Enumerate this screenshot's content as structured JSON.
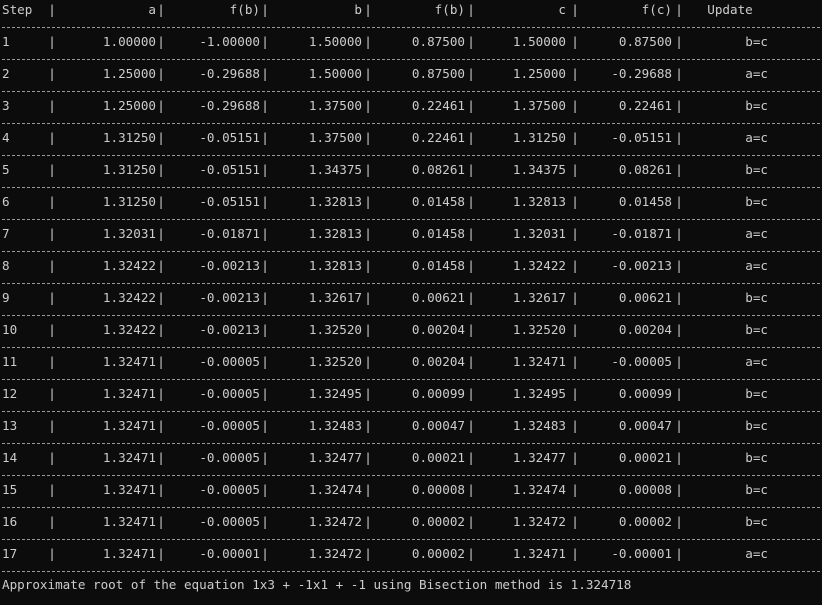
{
  "table": {
    "headers": [
      "Step",
      "a",
      "f(b)",
      "b",
      "f(b)",
      "c",
      "f(c)",
      "Update"
    ],
    "rows": [
      [
        "1",
        "1.00000",
        "-1.00000",
        "1.50000",
        "0.87500",
        "1.50000",
        "0.87500",
        "b=c"
      ],
      [
        "2",
        "1.25000",
        "-0.29688",
        "1.50000",
        "0.87500",
        "1.25000",
        "-0.29688",
        "a=c"
      ],
      [
        "3",
        "1.25000",
        "-0.29688",
        "1.37500",
        "0.22461",
        "1.37500",
        "0.22461",
        "b=c"
      ],
      [
        "4",
        "1.31250",
        "-0.05151",
        "1.37500",
        "0.22461",
        "1.31250",
        "-0.05151",
        "a=c"
      ],
      [
        "5",
        "1.31250",
        "-0.05151",
        "1.34375",
        "0.08261",
        "1.34375",
        "0.08261",
        "b=c"
      ],
      [
        "6",
        "1.31250",
        "-0.05151",
        "1.32813",
        "0.01458",
        "1.32813",
        "0.01458",
        "b=c"
      ],
      [
        "7",
        "1.32031",
        "-0.01871",
        "1.32813",
        "0.01458",
        "1.32031",
        "-0.01871",
        "a=c"
      ],
      [
        "8",
        "1.32422",
        "-0.00213",
        "1.32813",
        "0.01458",
        "1.32422",
        "-0.00213",
        "a=c"
      ],
      [
        "9",
        "1.32422",
        "-0.00213",
        "1.32617",
        "0.00621",
        "1.32617",
        "0.00621",
        "b=c"
      ],
      [
        "10",
        "1.32422",
        "-0.00213",
        "1.32520",
        "0.00204",
        "1.32520",
        "0.00204",
        "b=c"
      ],
      [
        "11",
        "1.32471",
        "-0.00005",
        "1.32520",
        "0.00204",
        "1.32471",
        "-0.00005",
        "a=c"
      ],
      [
        "12",
        "1.32471",
        "-0.00005",
        "1.32495",
        "0.00099",
        "1.32495",
        "0.00099",
        "b=c"
      ],
      [
        "13",
        "1.32471",
        "-0.00005",
        "1.32483",
        "0.00047",
        "1.32483",
        "0.00047",
        "b=c"
      ],
      [
        "14",
        "1.32471",
        "-0.00005",
        "1.32477",
        "0.00021",
        "1.32477",
        "0.00021",
        "b=c"
      ],
      [
        "15",
        "1.32471",
        "-0.00005",
        "1.32474",
        "0.00008",
        "1.32474",
        "0.00008",
        "b=c"
      ],
      [
        "16",
        "1.32471",
        "-0.00005",
        "1.32472",
        "0.00002",
        "1.32472",
        "0.00002",
        "b=c"
      ],
      [
        "17",
        "1.32471",
        "-0.00001",
        "1.32472",
        "0.00002",
        "1.32471",
        "-0.00001",
        "a=c"
      ]
    ]
  },
  "footer": "Approximate root of the equation 1x3 + -1x1 + -1 using Bisection method is 1.324718",
  "colors": {
    "background": "#0c0c0c",
    "text": "#cccccc",
    "rule": "#9a9a9a"
  }
}
